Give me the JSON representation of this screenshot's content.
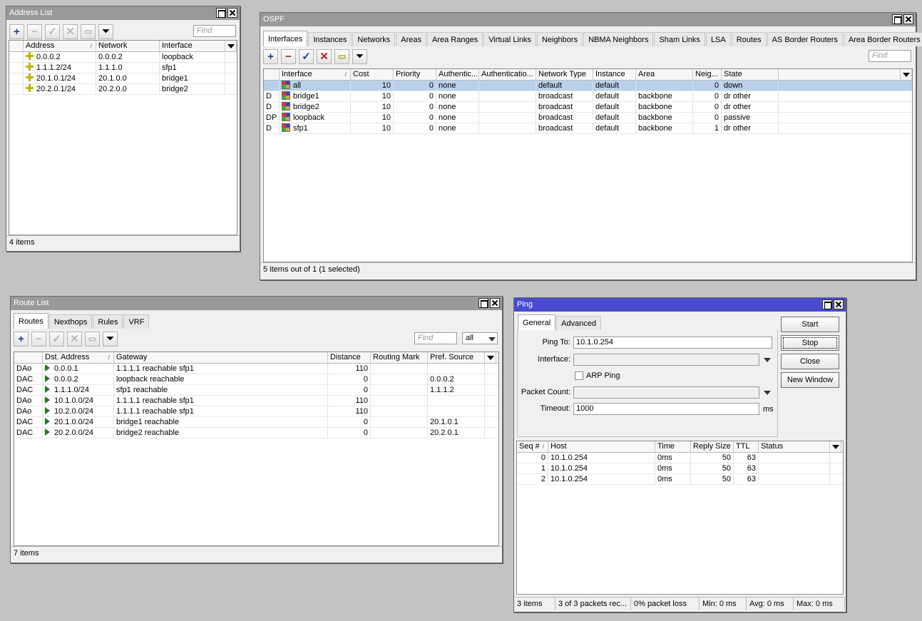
{
  "address_list": {
    "title": "Address List",
    "find_placeholder": "Find",
    "columns": [
      "Address",
      "Network",
      "Interface"
    ],
    "rows": [
      {
        "address": "0.0.0.2",
        "network": "0.0.0.2",
        "interface": "loopback"
      },
      {
        "address": "1.1.1.2/24",
        "network": "1.1.1.0",
        "interface": "sfp1"
      },
      {
        "address": "20.1.0.1/24",
        "network": "20.1.0.0",
        "interface": "bridge1"
      },
      {
        "address": "20.2.0.1/24",
        "network": "20.2.0.0",
        "interface": "bridge2"
      }
    ],
    "status": "4 items"
  },
  "ospf": {
    "title": "OSPF",
    "tabs": [
      "Interfaces",
      "Instances",
      "Networks",
      "Areas",
      "Area Ranges",
      "Virtual Links",
      "Neighbors",
      "NBMA Neighbors",
      "Sham Links",
      "LSA",
      "Routes",
      "AS Border Routers",
      "Area Border Routers"
    ],
    "find_placeholder": "Find",
    "columns": [
      "Interface",
      "Cost",
      "Priority",
      "Authentic...",
      "Authenticatio...",
      "Network Type",
      "Instance",
      "Area",
      "Neig...",
      "State"
    ],
    "rows": [
      {
        "flag": "",
        "interface": "all",
        "cost": "10",
        "priority": "0",
        "auth": "none",
        "auth_key": "",
        "network_type": "default",
        "instance": "default",
        "area": "",
        "neighbors": "0",
        "state": "down",
        "selected": true
      },
      {
        "flag": "D",
        "interface": "bridge1",
        "cost": "10",
        "priority": "0",
        "auth": "none",
        "auth_key": "",
        "network_type": "broadcast",
        "instance": "default",
        "area": "backbone",
        "neighbors": "0",
        "state": "dr other"
      },
      {
        "flag": "D",
        "interface": "bridge2",
        "cost": "10",
        "priority": "0",
        "auth": "none",
        "auth_key": "",
        "network_type": "broadcast",
        "instance": "default",
        "area": "backbone",
        "neighbors": "0",
        "state": "dr other"
      },
      {
        "flag": "DP",
        "interface": "loopback",
        "cost": "10",
        "priority": "0",
        "auth": "none",
        "auth_key": "",
        "network_type": "broadcast",
        "instance": "default",
        "area": "backbone",
        "neighbors": "0",
        "state": "passive"
      },
      {
        "flag": "D",
        "interface": "sfp1",
        "cost": "10",
        "priority": "0",
        "auth": "none",
        "auth_key": "",
        "network_type": "broadcast",
        "instance": "default",
        "area": "backbone",
        "neighbors": "1",
        "state": "dr other"
      }
    ],
    "status": "5 items out of 1 (1 selected)"
  },
  "route_list": {
    "title": "Route List",
    "tabs": [
      "Routes",
      "Nexthops",
      "Rules",
      "VRF"
    ],
    "find_placeholder": "Find",
    "filter_value": "all",
    "columns": [
      "Dst. Address",
      "Gateway",
      "Distance",
      "Routing Mark",
      "Pref. Source"
    ],
    "rows": [
      {
        "flag": "DAo",
        "dst": "0.0.0.1",
        "gateway": "1.1.1.1 reachable sfp1",
        "distance": "110",
        "mark": "",
        "pref": ""
      },
      {
        "flag": "DAC",
        "dst": "0.0.0.2",
        "gateway": "loopback reachable",
        "distance": "0",
        "mark": "",
        "pref": "0.0.0.2"
      },
      {
        "flag": "DAC",
        "dst": "1.1.1.0/24",
        "gateway": "sfp1 reachable",
        "distance": "0",
        "mark": "",
        "pref": "1.1.1.2"
      },
      {
        "flag": "DAo",
        "dst": "10.1.0.0/24",
        "gateway": "1.1.1.1 reachable sfp1",
        "distance": "110",
        "mark": "",
        "pref": ""
      },
      {
        "flag": "DAo",
        "dst": "10.2.0.0/24",
        "gateway": "1.1.1.1 reachable sfp1",
        "distance": "110",
        "mark": "",
        "pref": ""
      },
      {
        "flag": "DAC",
        "dst": "20.1.0.0/24",
        "gateway": "bridge1 reachable",
        "distance": "0",
        "mark": "",
        "pref": "20.1.0.1"
      },
      {
        "flag": "DAC",
        "dst": "20.2.0.0/24",
        "gateway": "bridge2 reachable",
        "distance": "0",
        "mark": "",
        "pref": "20.2.0.1"
      }
    ],
    "status": "7 items"
  },
  "ping": {
    "title": "Ping",
    "tabs": [
      "General",
      "Advanced"
    ],
    "labels": {
      "ping_to": "Ping To:",
      "interface": "Interface:",
      "arp_ping": "ARP Ping",
      "packet_count": "Packet Count:",
      "timeout": "Timeout:",
      "ms": "ms"
    },
    "values": {
      "ping_to": "10.1.0.254",
      "interface": "",
      "packet_count": "",
      "timeout": "1000"
    },
    "buttons": {
      "start": "Start",
      "stop": "Stop",
      "close": "Close",
      "new_window": "New Window"
    },
    "columns": [
      "Seq #",
      "Host",
      "Time",
      "Reply Size",
      "TTL",
      "Status"
    ],
    "rows": [
      {
        "seq": "0",
        "host": "10.1.0.254",
        "time": "0ms",
        "size": "50",
        "ttl": "63",
        "status": ""
      },
      {
        "seq": "1",
        "host": "10.1.0.254",
        "time": "0ms",
        "size": "50",
        "ttl": "63",
        "status": ""
      },
      {
        "seq": "2",
        "host": "10.1.0.254",
        "time": "0ms",
        "size": "50",
        "ttl": "63",
        "status": ""
      }
    ],
    "status": [
      "3 items",
      "3 of 3 packets rec...",
      "0% packet loss",
      "Min: 0 ms",
      "Avg: 0 ms",
      "Max: 0 ms"
    ]
  }
}
